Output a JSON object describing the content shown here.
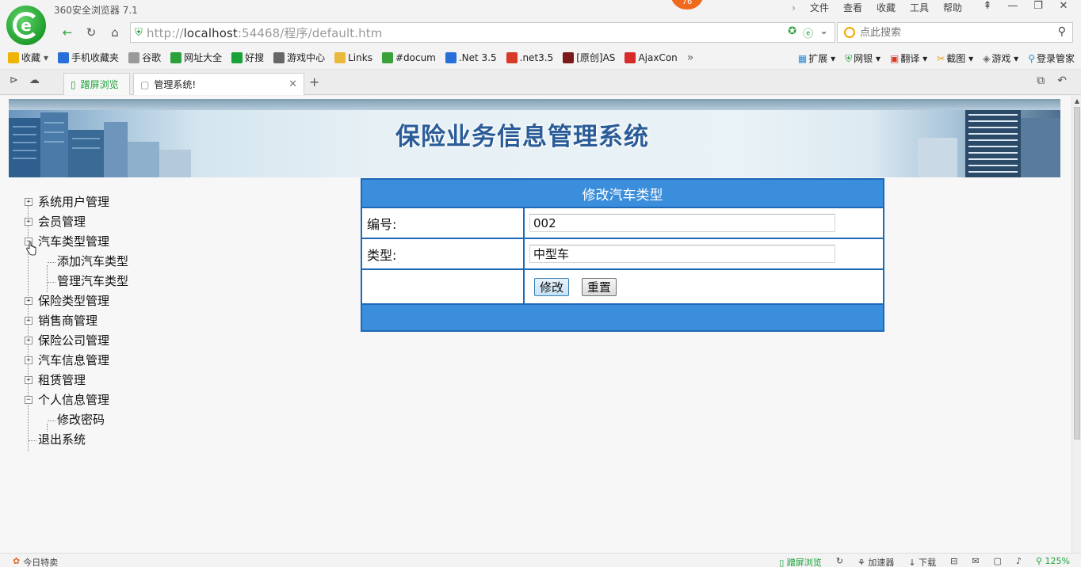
{
  "browser": {
    "app_title": "360安全浏览器 7.1",
    "badge": "76",
    "menu": [
      "文件",
      "查看",
      "收藏",
      "工具",
      "帮助"
    ],
    "url_prefix": "http://",
    "url_host": "localhost",
    "url_rest": ":54468/程序/default.htm",
    "search_placeholder": "点此搜索"
  },
  "favorites": [
    {
      "label": "收藏",
      "color": "#f0b400"
    },
    {
      "label": "手机收藏夹",
      "color": "#2a6fd8"
    },
    {
      "label": "谷歌",
      "color": "#9a9a9a"
    },
    {
      "label": "网址大全",
      "color": "#2aa13a"
    },
    {
      "label": "好搜",
      "color": "#1aa23a"
    },
    {
      "label": "游戏中心",
      "color": "#666666"
    },
    {
      "label": "Links",
      "color": "#e8b93a"
    },
    {
      "label": "#docum",
      "color": "#3aa03a"
    },
    {
      "label": ".Net 3.5",
      "color": "#2a6fd8"
    },
    {
      "label": ".net3.5",
      "color": "#d83a2a"
    },
    {
      "label": "[原创]AS",
      "color": "#7a1a1a"
    },
    {
      "label": "AjaxCon",
      "color": "#d82a2a"
    }
  ],
  "favorites_right": [
    "扩展",
    "网银",
    "翻译",
    "截图",
    "游戏",
    "登录管家"
  ],
  "tabs": {
    "split_label": "蹭屏浏览",
    "active_label": "管理系统!"
  },
  "page": {
    "banner_title": "保险业务信息管理系统",
    "tree": [
      {
        "label": "系统用户管理",
        "state": "collapsed"
      },
      {
        "label": "会员管理",
        "state": "collapsed"
      },
      {
        "label": "汽车类型管理",
        "state": "expanded"
      },
      {
        "label": "添加汽车类型",
        "state": "child"
      },
      {
        "label": "管理汽车类型",
        "state": "child"
      },
      {
        "label": "保险类型管理",
        "state": "collapsed"
      },
      {
        "label": "销售商管理",
        "state": "collapsed"
      },
      {
        "label": "保险公司管理",
        "state": "collapsed"
      },
      {
        "label": "汽车信息管理",
        "state": "collapsed"
      },
      {
        "label": "租赁管理",
        "state": "collapsed"
      },
      {
        "label": "个人信息管理",
        "state": "expanded"
      },
      {
        "label": "修改密码",
        "state": "child"
      },
      {
        "label": "退出系统",
        "state": "leaf"
      }
    ],
    "form": {
      "title": "修改汽车类型",
      "id_label": "编号:",
      "id_value": "002",
      "type_label": "类型:",
      "type_value": "中型车",
      "submit_label": "修改",
      "reset_label": "重置"
    }
  },
  "status": {
    "left": "今日特卖",
    "right": [
      "蹭屏浏览",
      "加速器",
      "下载",
      "125%"
    ]
  }
}
